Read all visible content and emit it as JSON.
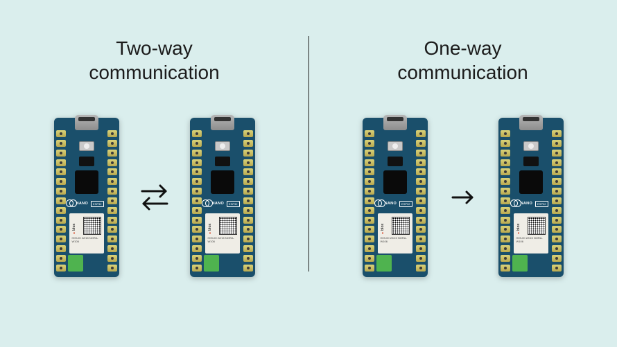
{
  "left": {
    "title_line1": "Two-way",
    "title_line2": "communication",
    "arrow_type": "bidirectional"
  },
  "right": {
    "title_line1": "One-way",
    "title_line2": "communication",
    "arrow_type": "unidirectional"
  },
  "board": {
    "brand": "ARDUINO",
    "model": "NANO ESP32",
    "module_vendor": "u-blox",
    "module_line1": "H09-00 22/15",
    "module_line2": "NORA-W106"
  }
}
